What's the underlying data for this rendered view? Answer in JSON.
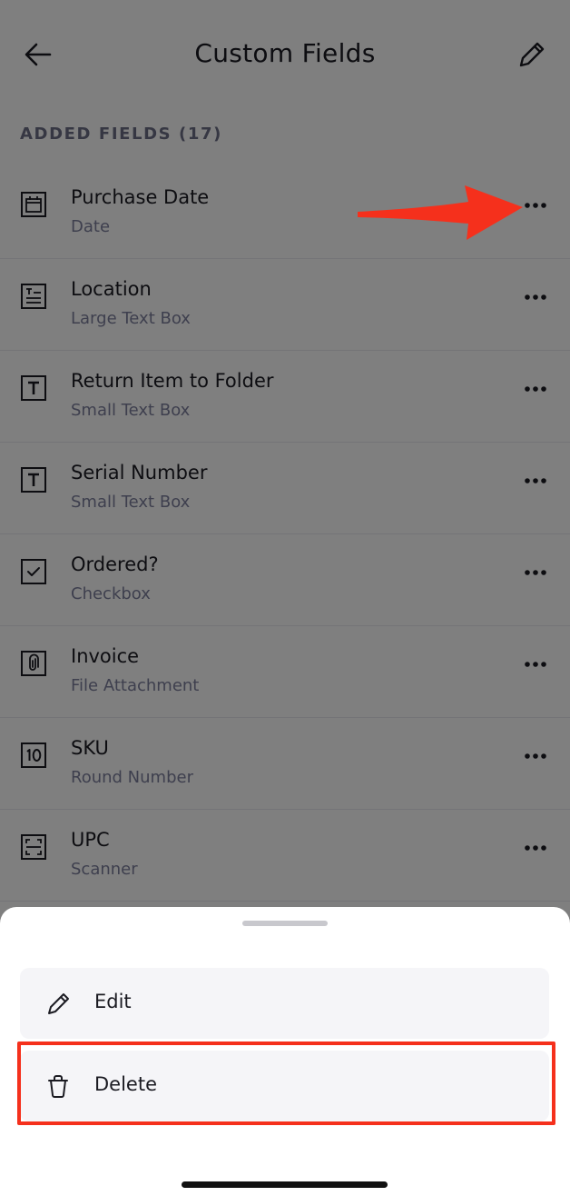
{
  "header": {
    "title": "Custom Fields",
    "back_icon": "arrow-left-icon",
    "edit_icon": "pencil-icon"
  },
  "section": {
    "label": "ADDED FIELDS (17)"
  },
  "fields": [
    {
      "name": "Purchase Date",
      "type": "Date",
      "icon": "calendar-icon"
    },
    {
      "name": "Location",
      "type": "Large Text Box",
      "icon": "large-text-box-icon"
    },
    {
      "name": "Return Item to Folder",
      "type": "Small Text Box",
      "icon": "small-text-box-icon"
    },
    {
      "name": "Serial Number",
      "type": "Small Text Box",
      "icon": "small-text-box-icon"
    },
    {
      "name": "Ordered?",
      "type": "Checkbox",
      "icon": "checkbox-icon"
    },
    {
      "name": "Invoice",
      "type": "File Attachment",
      "icon": "paperclip-icon"
    },
    {
      "name": "SKU",
      "type": "Round Number",
      "icon": "round-number-icon"
    },
    {
      "name": "UPC",
      "type": "Scanner",
      "icon": "scanner-icon"
    }
  ],
  "sheet": {
    "options": [
      {
        "label": "Edit",
        "icon": "pencil-icon"
      },
      {
        "label": "Delete",
        "icon": "trash-icon"
      }
    ]
  },
  "colors": {
    "annotation": "#f5301c",
    "overlay": "rgba(0,0,0,0.5)",
    "text_primary": "#1b1b22",
    "text_secondary": "#7c7f9c"
  }
}
